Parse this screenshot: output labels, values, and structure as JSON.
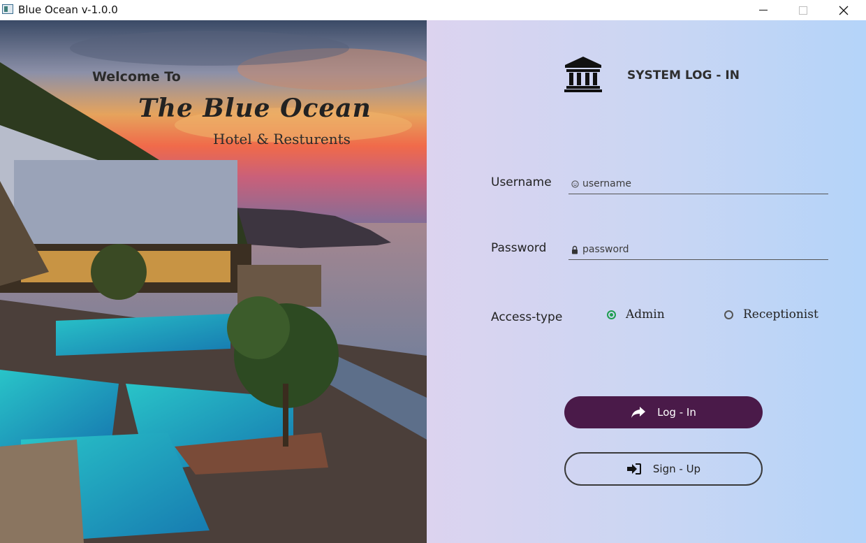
{
  "window": {
    "title": "Blue Ocean v-1.0.0",
    "controls": [
      "minimize",
      "maximize",
      "close"
    ]
  },
  "hero": {
    "welcome": "Welcome To",
    "brand": "The Blue Ocean",
    "subtitle": "Hotel & Resturents"
  },
  "login": {
    "title": "SYSTEM LOG - IN",
    "title_icon": "bank-icon",
    "username_label": "Username",
    "username_placeholder": "username",
    "username_icon": "user-circle-icon",
    "password_label": "Password",
    "password_placeholder": "password",
    "password_icon": "lock-icon",
    "access_label": "Access-type",
    "access_options": [
      {
        "label": "Admin",
        "selected": true
      },
      {
        "label": "Receptionist",
        "selected": false
      }
    ],
    "login_button": "Log - In",
    "login_icon": "share-arrow-icon",
    "signup_button": "Sign - Up",
    "signup_icon": "sign-in-icon"
  },
  "colors": {
    "primary_button": "#4a1a49",
    "radio_selected": "#1f9e4f",
    "panel_gradient_left": "#dcd3ef",
    "panel_gradient_right": "#b4d4f9"
  }
}
